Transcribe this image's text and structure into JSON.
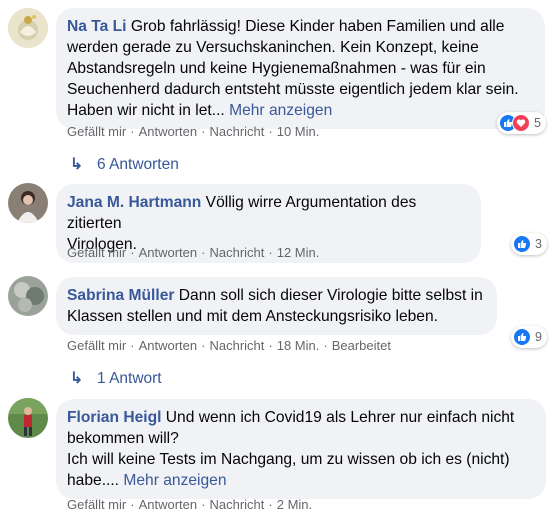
{
  "comments": [
    {
      "author": "Na Ta Li",
      "lines": [
        "Grob fahrlässig! Diese Kinder haben Familien und alle",
        "werden gerade zu Versuchskaninchen. Kein Konzept, keine",
        "Abstandsregeln und keine Hygienemaßnahmen - was für ein",
        "Seuchenherd dadurch entsteht müsste eigentlich jedem klar sein.",
        "Haben wir nicht in let..."
      ],
      "more": "Mehr anzeigen",
      "actions": {
        "like": "Gefällt mir",
        "reply": "Antworten",
        "message": "Nachricht",
        "time": "10 Min."
      },
      "reaction_count": "5",
      "reactions": [
        "like-icon",
        "love-icon"
      ],
      "replies": "6 Antworten"
    },
    {
      "author": "Jana M. Hartmann",
      "lines": [
        "Völlig wirre Argumentation des zitierten",
        "Virologen."
      ],
      "actions": {
        "like": "Gefällt mir",
        "reply": "Antworten",
        "message": "Nachricht",
        "time": "12 Min."
      },
      "reaction_count": "3",
      "reactions": [
        "like-icon"
      ]
    },
    {
      "author": "Sabrina Müller",
      "lines": [
        "Dann soll sich dieser Virologie bitte selbst in",
        "Klassen stellen und mit dem Ansteckungsrisiko leben."
      ],
      "actions": {
        "like": "Gefällt mir",
        "reply": "Antworten",
        "message": "Nachricht",
        "time": "18 Min.",
        "edited": "Bearbeitet"
      },
      "reaction_count": "9",
      "reactions": [
        "like-icon"
      ],
      "replies": "1 Antwort"
    },
    {
      "author": "Florian Heigl",
      "lines": [
        "Und wenn ich Covid19 als Lehrer nur einfach nicht",
        "bekommen will?",
        "Ich will keine Tests im Nachgang, um zu wissen ob ich es (nicht)",
        "habe...."
      ],
      "more": "Mehr anzeigen",
      "actions": {
        "like": "Gefällt mir",
        "reply": "Antworten",
        "message": "Nachricht",
        "time": "2 Min."
      }
    }
  ],
  "colors": {
    "bubble": "#f0f2f5",
    "author": "#385898",
    "meta": "#65676b",
    "like": "#1877f2",
    "love": "#f33e58"
  }
}
